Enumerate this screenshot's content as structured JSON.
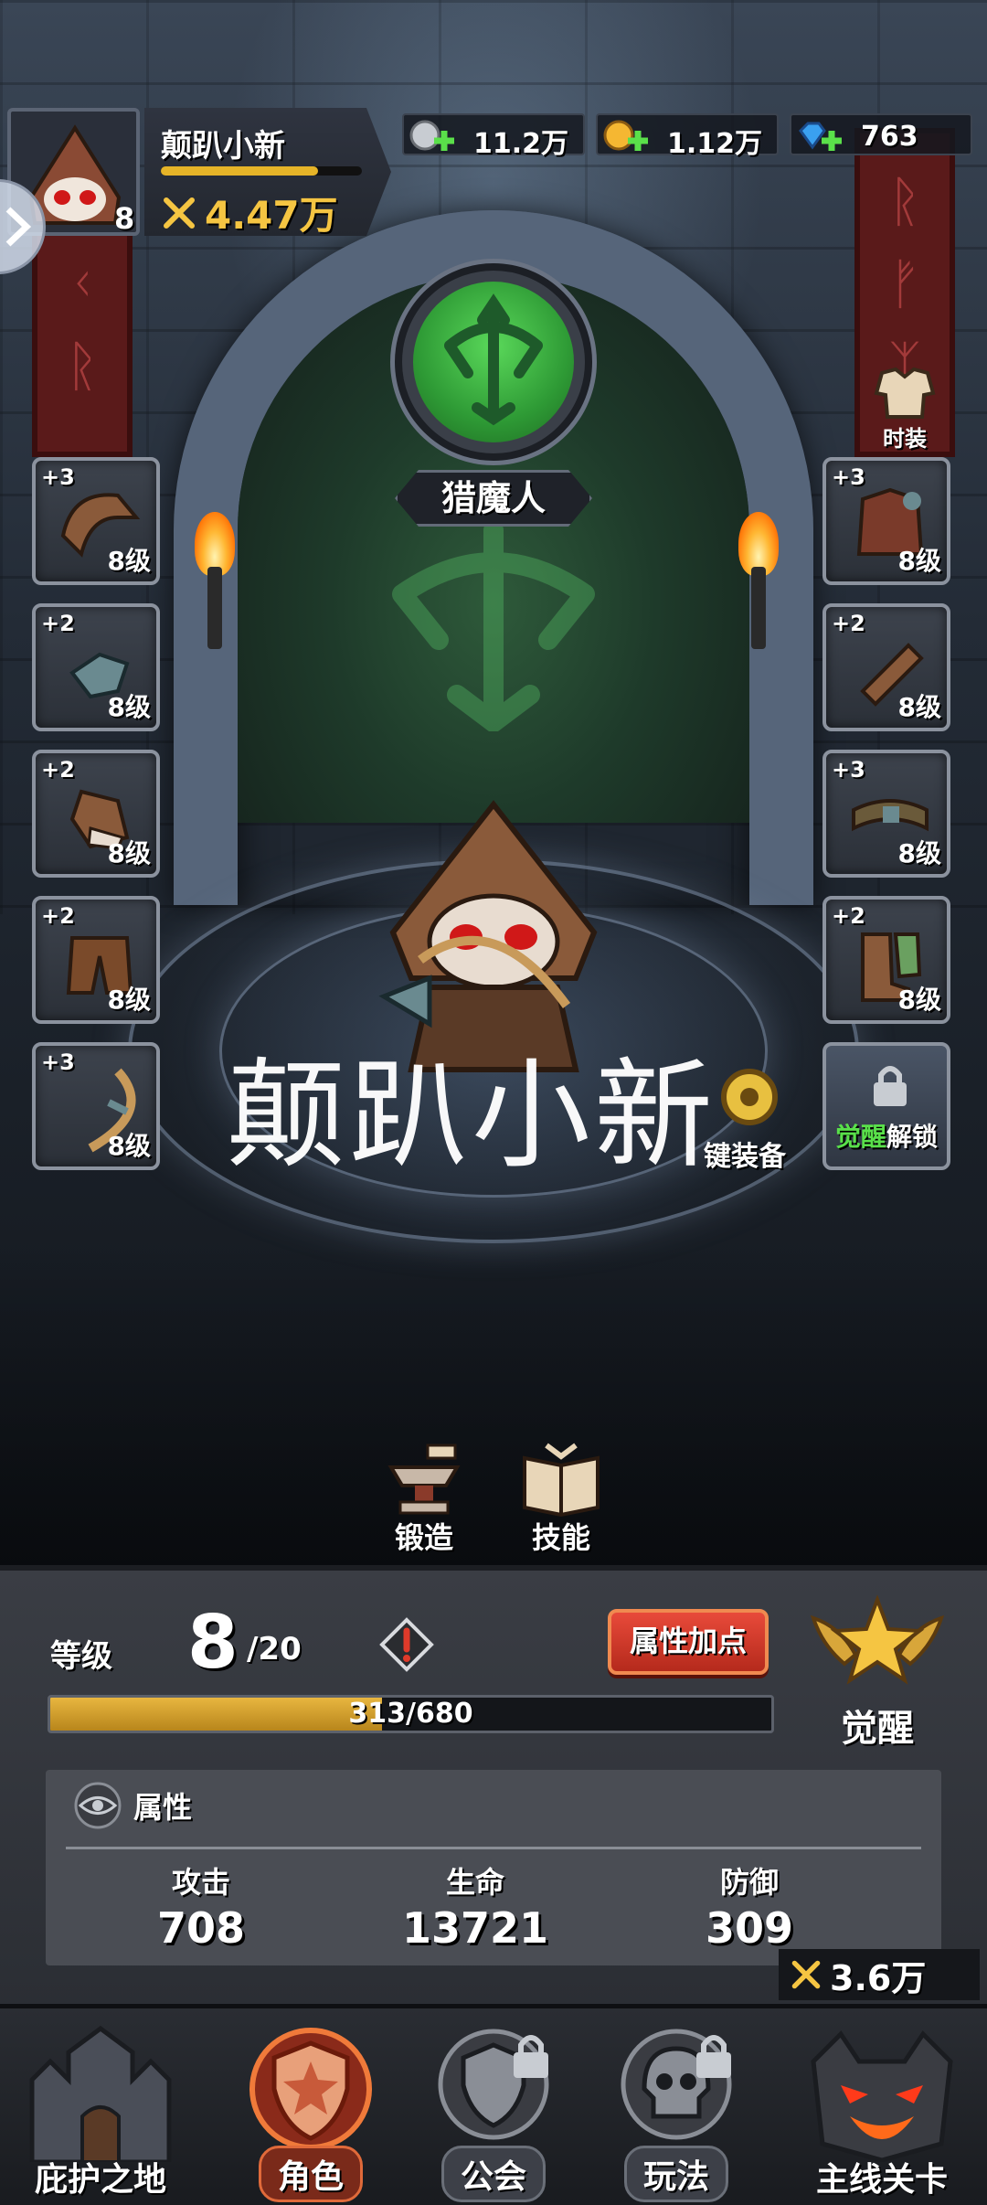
{
  "player": {
    "name": "颠趴小新",
    "avatar_level": "8",
    "power": "4.47万",
    "xp_fraction": 0.78
  },
  "currencies": [
    {
      "name": "silver",
      "value": "11.2万",
      "icon": "silver-coin-icon"
    },
    {
      "name": "gold",
      "value": "1.12万",
      "icon": "gold-coin-icon"
    },
    {
      "name": "gem",
      "value": "763",
      "icon": "gem-icon"
    }
  ],
  "class": {
    "name": "猎魔人",
    "emblem": "crossbow-emblem-icon"
  },
  "skin_button": "时装",
  "equipment": {
    "left": [
      {
        "plus": "+3",
        "level": "8级",
        "item": "hood-icon"
      },
      {
        "plus": "+2",
        "level": "8级",
        "item": "amulet-icon"
      },
      {
        "plus": "+2",
        "level": "8级",
        "item": "glove-icon"
      },
      {
        "plus": "+2",
        "level": "8级",
        "item": "pants-icon"
      },
      {
        "plus": "+3",
        "level": "8级",
        "item": "bow-icon"
      }
    ],
    "right": [
      {
        "plus": "+3",
        "level": "8级",
        "item": "armor-icon"
      },
      {
        "plus": "+2",
        "level": "8级",
        "item": "bracer-icon"
      },
      {
        "plus": "+3",
        "level": "8级",
        "item": "belt-icon"
      },
      {
        "plus": "+2",
        "level": "8级",
        "item": "boots-icon"
      }
    ]
  },
  "one_key_equip": "键装备",
  "awaken_unlock": {
    "green": "觉醒",
    "rest": "解锁"
  },
  "watermark": "颠趴小新",
  "actions": {
    "forge": "锻造",
    "skill": "技能"
  },
  "stats_panel": {
    "level_label": "等级",
    "level": "8",
    "level_max": "/20",
    "attr_add_button": "属性加点",
    "awaken_label": "觉醒",
    "exp_text": "313/680",
    "exp_current": 313,
    "exp_max": 680,
    "attributes_title": "属性",
    "stats": [
      {
        "key": "攻击",
        "value": "708"
      },
      {
        "key": "生命",
        "value": "13721"
      },
      {
        "key": "防御",
        "value": "309"
      }
    ]
  },
  "stage_power": "3.6万",
  "bottom_nav": [
    {
      "label": "庇护之地",
      "icon": "castle-icon",
      "active": false,
      "locked": false
    },
    {
      "label": "角色",
      "icon": "hero-shield-icon",
      "active": true,
      "locked": false
    },
    {
      "label": "公会",
      "icon": "guild-icon",
      "active": false,
      "locked": true
    },
    {
      "label": "玩法",
      "icon": "skull-icon",
      "active": false,
      "locked": true
    },
    {
      "label": "主线关卡",
      "icon": "demon-icon",
      "active": false,
      "locked": false
    }
  ],
  "colors": {
    "gold": "#f5c542",
    "green": "#59e04a",
    "red_button": "#e84a3a"
  }
}
